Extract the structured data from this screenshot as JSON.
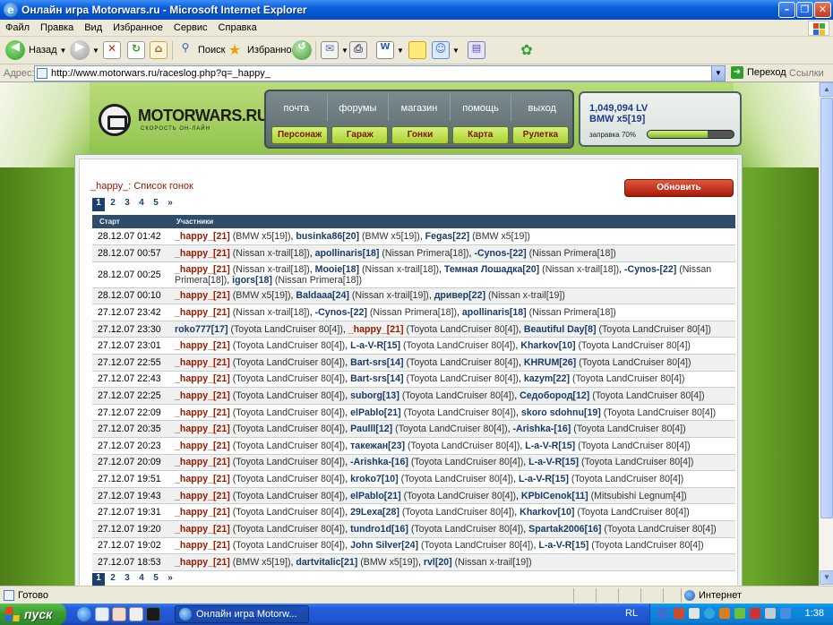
{
  "window": {
    "title": "Онлайн игра Motorwars.ru - Microsoft Internet Explorer"
  },
  "menu": [
    "Файл",
    "Правка",
    "Вид",
    "Избранное",
    "Сервис",
    "Справка"
  ],
  "toolbar": {
    "back": "Назад",
    "search": "Поиск",
    "favorites": "Избранное"
  },
  "address": {
    "label": "Адрес:",
    "url": "http://www.motorwars.ru/raceslog.php?q=_happy_",
    "go": "Переход",
    "links": "Ссылки"
  },
  "site": {
    "logo_name": "MOTORWARS.RU",
    "logo_tagline": "СКОРОСТЬ ОН-ЛАЙН",
    "top_links": [
      "почта",
      "форумы",
      "магазин",
      "помощь",
      "выход"
    ],
    "buttons": [
      "Персонаж",
      "Гараж",
      "Гонки",
      "Карта",
      "Рулетка"
    ],
    "money": "1,049,094 LV",
    "car": "BMW x5[19]",
    "fuel_label": "заправка 70%",
    "fuel_level": 0.7
  },
  "page": {
    "title": "_happy_: Список гонок",
    "refresh": "Обновить",
    "pages": [
      "1",
      "2",
      "3",
      "4",
      "5",
      "»"
    ],
    "current_page": "1",
    "columns": [
      "Старт",
      "Участники"
    ],
    "rows": [
      {
        "date": "28.12.07 01:42",
        "p": [
          [
            "_happy_[21]",
            "(BMW x5[19])"
          ],
          [
            "businka86[20]",
            "(BMW x5[19])"
          ],
          [
            "Fegas[22]",
            "(BMW x5[19])"
          ]
        ]
      },
      {
        "date": "28.12.07 00:57",
        "p": [
          [
            "_happy_[21]",
            "(Nissan x-trail[18])"
          ],
          [
            "apollinaris[18]",
            "(Nissan Primera[18])"
          ],
          [
            "-Cynos-[22]",
            "(Nissan Primera[18])"
          ]
        ]
      },
      {
        "date": "28.12.07 00:25",
        "p": [
          [
            "_happy_[21]",
            "(Nissan x-trail[18])"
          ],
          [
            "Mooie[18]",
            "(Nissan x-trail[18])"
          ],
          [
            "Темная Лошадка[20]",
            "(Nissan x-trail[18])"
          ],
          [
            "-Cynos-[22]",
            "(Nissan Primera[18])"
          ],
          [
            "igors[18]",
            "(Nissan Primera[18])"
          ]
        ]
      },
      {
        "date": "28.12.07 00:10",
        "p": [
          [
            "_happy_[21]",
            "(BMW x5[19])"
          ],
          [
            "Baldaaa[24]",
            "(Nissan x-trail[19])"
          ],
          [
            "дривер[22]",
            "(Nissan x-trail[19])"
          ]
        ]
      },
      {
        "date": "27.12.07 23:42",
        "p": [
          [
            "_happy_[21]",
            "(Nissan x-trail[18])"
          ],
          [
            "-Cynos-[22]",
            "(Nissan Primera[18])"
          ],
          [
            "apollinaris[18]",
            "(Nissan Primera[18])"
          ]
        ]
      },
      {
        "date": "27.12.07 23:30",
        "p": [
          [
            "roko777[17]",
            "(Toyota LandCruiser 80[4])"
          ],
          [
            "_happy_[21]",
            "(Toyota LandCruiser 80[4])"
          ],
          [
            "Beautiful Day[8]",
            "(Toyota LandCruiser 80[4])"
          ]
        ]
      },
      {
        "date": "27.12.07 23:01",
        "p": [
          [
            "_happy_[21]",
            "(Toyota LandCruiser 80[4])"
          ],
          [
            "L-a-V-R[15]",
            "(Toyota LandCruiser 80[4])"
          ],
          [
            "Kharkov[10]",
            "(Toyota LandCruiser 80[4])"
          ]
        ]
      },
      {
        "date": "27.12.07 22:55",
        "p": [
          [
            "_happy_[21]",
            "(Toyota LandCruiser 80[4])"
          ],
          [
            "Bart-srs[14]",
            "(Toyota LandCruiser 80[4])"
          ],
          [
            "KHRUM[26]",
            "(Toyota LandCruiser 80[4])"
          ]
        ]
      },
      {
        "date": "27.12.07 22:43",
        "p": [
          [
            "_happy_[21]",
            "(Toyota LandCruiser 80[4])"
          ],
          [
            "Bart-srs[14]",
            "(Toyota LandCruiser 80[4])"
          ],
          [
            "kazym[22]",
            "(Toyota LandCruiser 80[4])"
          ]
        ]
      },
      {
        "date": "27.12.07 22:25",
        "p": [
          [
            "_happy_[21]",
            "(Toyota LandCruiser 80[4])"
          ],
          [
            "suborg[13]",
            "(Toyota LandCruiser 80[4])"
          ],
          [
            "Седобород[12]",
            "(Toyota LandCruiser 80[4])"
          ]
        ]
      },
      {
        "date": "27.12.07 22:09",
        "p": [
          [
            "_happy_[21]",
            "(Toyota LandCruiser 80[4])"
          ],
          [
            "elPablo[21]",
            "(Toyota LandCruiser 80[4])"
          ],
          [
            "skoro sdohnu[19]",
            "(Toyota LandCruiser 80[4])"
          ]
        ]
      },
      {
        "date": "27.12.07 20:35",
        "p": [
          [
            "_happy_[21]",
            "(Toyota LandCruiser 80[4])"
          ],
          [
            "Paulll[12]",
            "(Toyota LandCruiser 80[4])"
          ],
          [
            "-Arishka-[16]",
            "(Toyota LandCruiser 80[4])"
          ]
        ]
      },
      {
        "date": "27.12.07 20:23",
        "p": [
          [
            "_happy_[21]",
            "(Toyota LandCruiser 80[4])"
          ],
          [
            "такежан[23]",
            "(Toyota LandCruiser 80[4])"
          ],
          [
            "L-a-V-R[15]",
            "(Toyota LandCruiser 80[4])"
          ]
        ]
      },
      {
        "date": "27.12.07 20:09",
        "p": [
          [
            "_happy_[21]",
            "(Toyota LandCruiser 80[4])"
          ],
          [
            "-Arishka-[16]",
            "(Toyota LandCruiser 80[4])"
          ],
          [
            "L-a-V-R[15]",
            "(Toyota LandCruiser 80[4])"
          ]
        ]
      },
      {
        "date": "27.12.07 19:51",
        "p": [
          [
            "_happy_[21]",
            "(Toyota LandCruiser 80[4])"
          ],
          [
            "kroko7[10]",
            "(Toyota LandCruiser 80[4])"
          ],
          [
            "L-a-V-R[15]",
            "(Toyota LandCruiser 80[4])"
          ]
        ]
      },
      {
        "date": "27.12.07 19:43",
        "p": [
          [
            "_happy_[21]",
            "(Toyota LandCruiser 80[4])"
          ],
          [
            "elPablo[21]",
            "(Toyota LandCruiser 80[4])"
          ],
          [
            "KPbICenok[11]",
            "(Mitsubishi Legnum[4])"
          ]
        ]
      },
      {
        "date": "27.12.07 19:31",
        "p": [
          [
            "_happy_[21]",
            "(Toyota LandCruiser 80[4])"
          ],
          [
            "29Lexa[28]",
            "(Toyota LandCruiser 80[4])"
          ],
          [
            "Kharkov[10]",
            "(Toyota LandCruiser 80[4])"
          ]
        ]
      },
      {
        "date": "27.12.07 19:20",
        "p": [
          [
            "_happy_[21]",
            "(Toyota LandCruiser 80[4])"
          ],
          [
            "tundro1d[16]",
            "(Toyota LandCruiser 80[4])"
          ],
          [
            "Spartak2006[16]",
            "(Toyota LandCruiser 80[4])"
          ]
        ]
      },
      {
        "date": "27.12.07 19:02",
        "p": [
          [
            "_happy_[21]",
            "(Toyota LandCruiser 80[4])"
          ],
          [
            "John Silver[24]",
            "(Toyota LandCruiser 80[4])"
          ],
          [
            "L-a-V-R[15]",
            "(Toyota LandCruiser 80[4])"
          ]
        ]
      },
      {
        "date": "27.12.07 18:53",
        "p": [
          [
            "_happy_[21]",
            "(BMW x5[19])"
          ],
          [
            "dartvitalic[21]",
            "(BMW x5[19])"
          ],
          [
            "rvl[20]",
            "(Nissan x-trail[19])"
          ]
        ]
      }
    ]
  },
  "status": {
    "text": "Готово",
    "zone": "Интернет"
  },
  "taskbar": {
    "start": "пуск",
    "item": "Онлайн игра Motorw...",
    "lang": "RL",
    "clock": "1:38"
  },
  "colors": {
    "accent_red": "#a01800",
    "player_blue": "#1b3b69",
    "header": "#2f4d6b"
  }
}
